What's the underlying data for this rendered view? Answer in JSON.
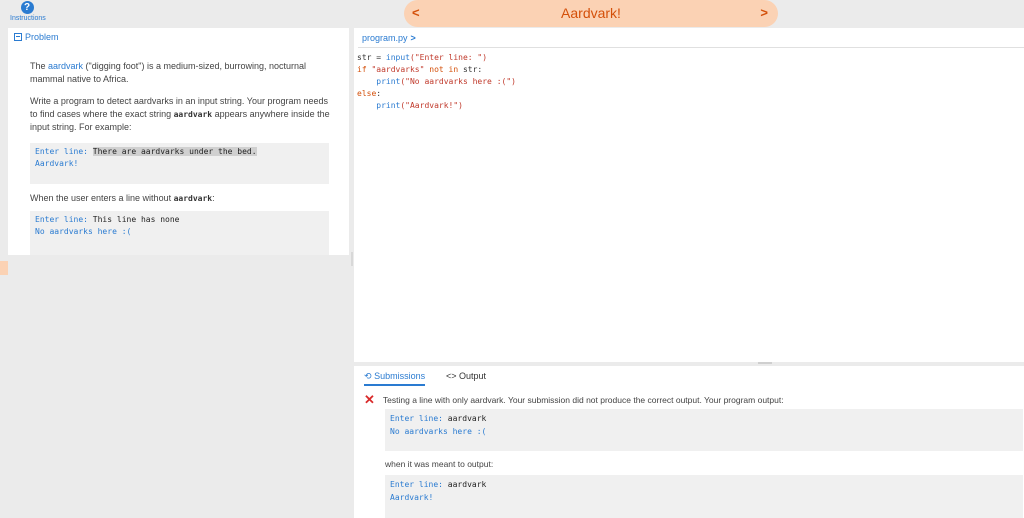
{
  "header": {
    "help_icon": "question-icon",
    "help_symbol": "?",
    "help_label": "Instructions",
    "prev_symbol": "<",
    "next_symbol": ">",
    "title": "Aardvark!",
    "accent_color": "#d4500a",
    "pill_color": "#fbd2b4"
  },
  "problem": {
    "tab_label": "Problem",
    "intro_link": "aardvark",
    "intro_rest": " (\"digging foot\") is a medium-sized, burrowing, nocturnal mammal native to Africa.",
    "intro_prefix": "The ",
    "task_1": "Write a program to detect aardvarks in an input string. Your program needs to find cases where the exact string ",
    "task_code": "aardvark",
    "task_2": " appears anywhere inside the input string. For example:",
    "example1": {
      "prompt": "Enter line: ",
      "input": "There are aardvarks under the bed.",
      "output": "Aardvark!"
    },
    "when_text": "When the user enters a line without ",
    "when_code": "aardvark",
    "when_end": ":",
    "example2": {
      "prompt": "Enter line: ",
      "input": "This line has none",
      "output": "No aardvarks here :("
    }
  },
  "editor": {
    "file_name": "program.py",
    "file_chevron": ">",
    "code": {
      "l1_var": "str = ",
      "l1_fn": "input",
      "l1_str": "(\"Enter line: \")",
      "l2_kw1": "if ",
      "l2_str": "\"aardvarks\"",
      "l2_kw2": " not in ",
      "l2_var": "str:",
      "l3_fn": "    print",
      "l3_str": "(\"No aardvarks here :(\")",
      "l4_kw": "else",
      "l4_colon": ":",
      "l5_fn": "    print",
      "l5_str": "(\"Aardvark!\")"
    }
  },
  "output": {
    "tabs": {
      "submissions": "Submissions",
      "submissions_icon": "history-icon",
      "output": "Output",
      "output_icon": "code-brackets-icon"
    },
    "fail_symbol": "✕",
    "message": "Testing a line with only aardvark. Your submission did not produce the correct output. Your program output:",
    "actual": {
      "prompt": "Enter line: ",
      "input": "aardvark",
      "output": "No aardvarks here :("
    },
    "meant_label": "when it was meant to output:",
    "expected": {
      "prompt": "Enter line: ",
      "input": "aardvark",
      "output": "Aardvark!"
    }
  }
}
